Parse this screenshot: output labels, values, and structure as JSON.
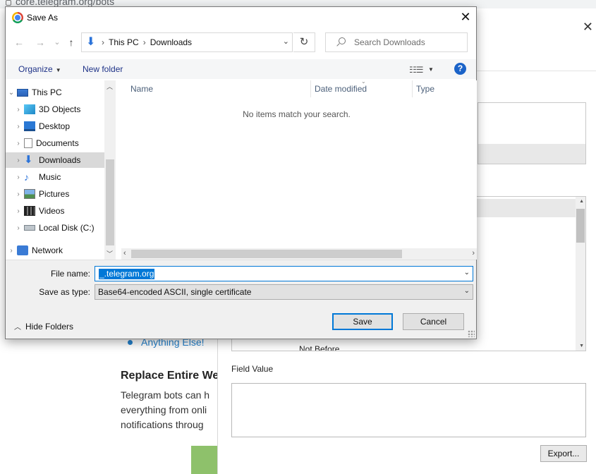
{
  "browser": {
    "url": "core.telegram.org/bots"
  },
  "background_page": {
    "bullet": "Anything Else!",
    "heading": "Replace Entire We",
    "paragraph_lines": [
      "Telegram bots can h",
      "everything from onli",
      "notifications throug"
    ]
  },
  "cert_viewer": {
    "close_glyph": "✕",
    "list_item_partial": "Not Before",
    "field_value_label": "Field Value",
    "export_label": "Export..."
  },
  "save_dialog": {
    "title": "Save As",
    "close_glyph": "✕",
    "nav": {
      "back": "←",
      "forward": "→",
      "recent": "⌄",
      "up": "↑"
    },
    "breadcrumb": [
      "This PC",
      "Downloads"
    ],
    "search_placeholder": "Search Downloads",
    "toolbar": {
      "organize_label": "Organize",
      "new_folder_label": "New folder",
      "help_glyph": "?"
    },
    "tree": [
      {
        "label": "This PC",
        "icon": "pc-icon",
        "selected": false
      },
      {
        "label": "3D Objects",
        "icon": "3d-objects-icon",
        "selected": false
      },
      {
        "label": "Desktop",
        "icon": "desktop-icon",
        "selected": false
      },
      {
        "label": "Documents",
        "icon": "documents-icon",
        "selected": false
      },
      {
        "label": "Downloads",
        "icon": "downloads-icon",
        "selected": true
      },
      {
        "label": "Music",
        "icon": "music-icon",
        "selected": false
      },
      {
        "label": "Pictures",
        "icon": "pictures-icon",
        "selected": false
      },
      {
        "label": "Videos",
        "icon": "videos-icon",
        "selected": false
      },
      {
        "label": "Local Disk (C:)",
        "icon": "disk-icon",
        "selected": false
      },
      {
        "label": "Network",
        "icon": "network-icon",
        "selected": false
      }
    ],
    "columns": [
      "Name",
      "Date modified",
      "Type"
    ],
    "empty_message": "No items match your search.",
    "file_name_label": "File name:",
    "file_name_value": "_.telegram.org",
    "save_type_label": "Save as type:",
    "save_type_value": "Base64-encoded ASCII, single certificate",
    "save_label": "Save",
    "cancel_label": "Cancel",
    "hide_folders_label": "Hide Folders"
  },
  "colors": {
    "accent": "#0078d7",
    "link_blue": "#2481cc",
    "selected_bg": "#d9d9d9"
  }
}
